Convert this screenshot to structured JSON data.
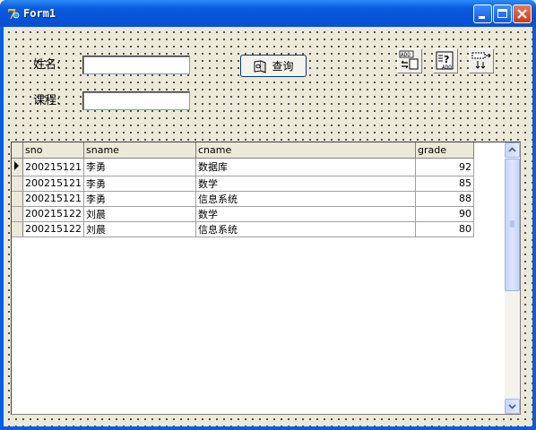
{
  "window": {
    "title": "Form1",
    "controls": [
      "minimize-icon",
      "maximize-icon",
      "close-icon"
    ]
  },
  "form": {
    "name_label": "姓名:",
    "name_value": "",
    "course_label": "课程:",
    "course_value": "",
    "query_button_label": "查询",
    "query_button_icon": "query-icon",
    "components": [
      "ado-connection-icon",
      "ado-query-icon",
      "datasource-icon"
    ]
  },
  "grid": {
    "columns": [
      "sno",
      "sname",
      "cname",
      "grade"
    ],
    "rows": [
      [
        "200215121",
        "李勇",
        "数据库",
        "92"
      ],
      [
        "200215121",
        "李勇",
        "数学",
        "85"
      ],
      [
        "200215121",
        "李勇",
        "信息系统",
        "88"
      ],
      [
        "200215122",
        "刘晨",
        "数学",
        "90"
      ],
      [
        "200215122",
        "刘晨",
        "信息系统",
        "80"
      ]
    ],
    "current_row": 0
  },
  "colors": {
    "title_bar": "#0a5ce0",
    "form_bg": "#ece9d8",
    "close_button": "#c83c1c"
  }
}
